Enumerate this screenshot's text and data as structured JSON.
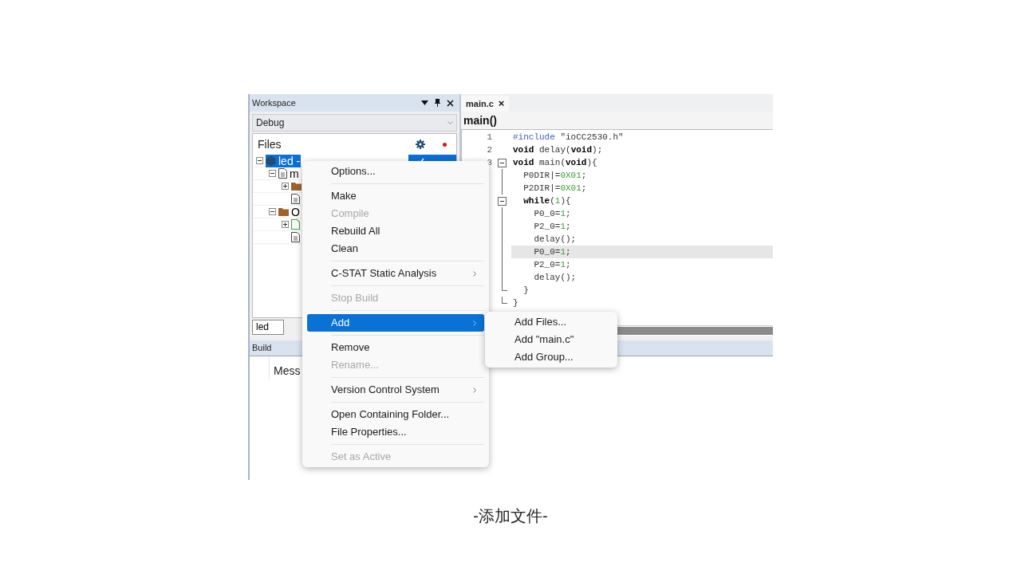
{
  "workspace": {
    "title": "Workspace",
    "configuration": "Debug",
    "files_header": "Files",
    "tree": [
      {
        "label": "led -",
        "kind": "project",
        "selected": true,
        "checked": true,
        "expanded": true,
        "children": [
          {
            "label": "m",
            "kind": "cfile",
            "selected": false,
            "expanded": true,
            "children": [
              {
                "kind": "folder",
                "selected": false,
                "expanded": false
              },
              {
                "kind": "hfile",
                "selected": false
              }
            ]
          },
          {
            "label": "O",
            "kind": "folder",
            "selected": false,
            "expanded": true,
            "children": [
              {
                "kind": "newfile",
                "selected": false,
                "expanded": false
              },
              {
                "kind": "docfile",
                "selected": false
              }
            ]
          }
        ]
      }
    ],
    "bottom_tab": "led"
  },
  "editor": {
    "tab": "main.c",
    "tab_close": "×",
    "function": "main()",
    "lines": [
      {
        "number": "1",
        "kind": "plain",
        "highlighted": false,
        "tokens": [
          {
            "text": "#include ",
            "kind": "preproc"
          },
          {
            "text": "\"ioCC2530.h\"",
            "kind": "plain"
          }
        ]
      },
      {
        "number": "2",
        "kind": "plain",
        "highlighted": false,
        "tokens": [
          {
            "text": "void",
            "kind": "keyword"
          },
          {
            "text": " delay(",
            "kind": "plain"
          },
          {
            "text": "void",
            "kind": "keyword"
          },
          {
            "text": ");",
            "kind": "plain"
          }
        ]
      },
      {
        "number": "3",
        "kind": "open",
        "highlighted": false,
        "tokens": [
          {
            "text": "void",
            "kind": "keyword"
          },
          {
            "text": " main(",
            "kind": "plain"
          },
          {
            "text": "void",
            "kind": "keyword"
          },
          {
            "text": "){",
            "kind": "plain"
          }
        ]
      },
      {
        "kind": "inside",
        "highlighted": false,
        "tokens": [
          {
            "text": "  P0DIR|=",
            "kind": "plain"
          },
          {
            "text": "0X01",
            "kind": "number"
          },
          {
            "text": ";",
            "kind": "plain"
          }
        ]
      },
      {
        "kind": "inside",
        "highlighted": false,
        "tokens": [
          {
            "text": "  P2DIR|=",
            "kind": "plain"
          },
          {
            "text": "0X01",
            "kind": "number"
          },
          {
            "text": ";",
            "kind": "plain"
          }
        ]
      },
      {
        "kind": "open",
        "highlighted": false,
        "tokens": [
          {
            "text": "  while",
            "kind": "keyword"
          },
          {
            "text": "(",
            "kind": "plain"
          },
          {
            "text": "1",
            "kind": "number"
          },
          {
            "text": "){",
            "kind": "plain"
          }
        ]
      },
      {
        "kind": "inside",
        "highlighted": false,
        "tokens": [
          {
            "text": "    P0_0=",
            "kind": "plain"
          },
          {
            "text": "1",
            "kind": "number"
          },
          {
            "text": ";",
            "kind": "plain"
          }
        ]
      },
      {
        "kind": "inside",
        "highlighted": false,
        "tokens": [
          {
            "text": "    P2_0=",
            "kind": "plain"
          },
          {
            "text": "1",
            "kind": "number"
          },
          {
            "text": ";",
            "kind": "plain"
          }
        ]
      },
      {
        "kind": "inside",
        "highlighted": false,
        "tokens": [
          {
            "text": "    delay();",
            "kind": "plain"
          }
        ]
      },
      {
        "kind": "inside",
        "highlighted": true,
        "tokens": [
          {
            "text": "    P0_0=",
            "kind": "plain"
          },
          {
            "text": "1",
            "kind": "number"
          },
          {
            "text": ";",
            "kind": "plain"
          }
        ]
      },
      {
        "kind": "inside",
        "highlighted": false,
        "tokens": [
          {
            "text": "    P2_0=",
            "kind": "plain"
          },
          {
            "text": "1",
            "kind": "number"
          },
          {
            "text": ";",
            "kind": "plain"
          }
        ]
      },
      {
        "kind": "inside",
        "highlighted": false,
        "tokens": [
          {
            "text": "    delay();",
            "kind": "plain"
          }
        ]
      },
      {
        "kind": "close",
        "highlighted": false,
        "tokens": [
          {
            "text": "  }",
            "kind": "plain"
          }
        ]
      },
      {
        "kind": "close",
        "highlighted": false,
        "tokens": [
          {
            "text": "}",
            "kind": "plain"
          }
        ]
      }
    ]
  },
  "build": {
    "title": "Build",
    "column": "Mess"
  },
  "context_menu": [
    {
      "kind": "item",
      "label": "Options...",
      "disabled": false,
      "selected": false,
      "submenu": false
    },
    {
      "kind": "separator"
    },
    {
      "kind": "item",
      "label": "Make",
      "disabled": false,
      "selected": false,
      "submenu": false
    },
    {
      "kind": "item",
      "label": "Compile",
      "disabled": true,
      "selected": false,
      "submenu": false
    },
    {
      "kind": "item",
      "label": "Rebuild All",
      "disabled": false,
      "selected": false,
      "submenu": false
    },
    {
      "kind": "item",
      "label": "Clean",
      "disabled": false,
      "selected": false,
      "submenu": false
    },
    {
      "kind": "separator"
    },
    {
      "kind": "item",
      "label": "C-STAT Static Analysis",
      "disabled": false,
      "selected": false,
      "submenu": true
    },
    {
      "kind": "separator"
    },
    {
      "kind": "item",
      "label": "Stop Build",
      "disabled": true,
      "selected": false,
      "submenu": false
    },
    {
      "kind": "separator"
    },
    {
      "kind": "item",
      "label": "Add",
      "disabled": false,
      "selected": true,
      "submenu": true
    },
    {
      "kind": "separator"
    },
    {
      "kind": "item",
      "label": "Remove",
      "disabled": false,
      "selected": false,
      "submenu": false
    },
    {
      "kind": "item",
      "label": "Rename...",
      "disabled": true,
      "selected": false,
      "submenu": false
    },
    {
      "kind": "separator"
    },
    {
      "kind": "item",
      "label": "Version Control System",
      "disabled": false,
      "selected": false,
      "submenu": true
    },
    {
      "kind": "separator"
    },
    {
      "kind": "item",
      "label": "Open Containing Folder...",
      "disabled": false,
      "selected": false,
      "submenu": false
    },
    {
      "kind": "item",
      "label": "File Properties...",
      "disabled": false,
      "selected": false,
      "submenu": false
    },
    {
      "kind": "separator"
    },
    {
      "kind": "item",
      "label": "Set as Active",
      "disabled": true,
      "selected": false,
      "submenu": false
    }
  ],
  "submenu": [
    "Add Files...",
    "Add \"main.c\"",
    "Add Group..."
  ],
  "caption": "-添加文件-"
}
